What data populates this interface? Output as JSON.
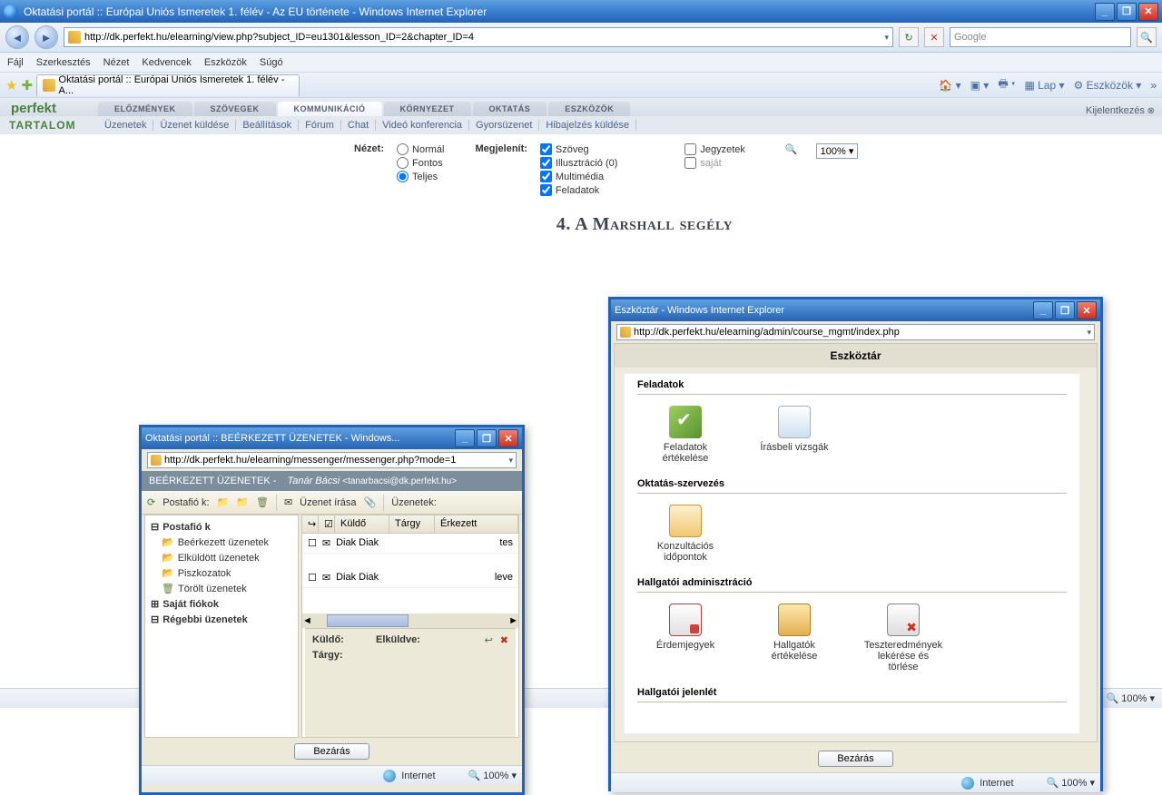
{
  "main_window": {
    "title": "Oktatási portál :: Európai Uniós Ismeretek 1. félév - Az EU története - Windows Internet Explorer",
    "url": "http://dk.perfekt.hu/elearning/view.php?subject_ID=eu1301&lesson_ID=2&chapter_ID=4",
    "search_placeholder": "Google",
    "tab_label": "Oktatási portál :: Európai Uniós Ismeretek 1. félév - A..."
  },
  "menus": {
    "file": "Fájl",
    "edit": "Szerkesztés",
    "view": "Nézet",
    "favs": "Kedvencek",
    "tools": "Eszközök",
    "help": "Súgó"
  },
  "toolbar": {
    "page": "Lap",
    "tools": "Eszközök"
  },
  "portal": {
    "logo": "perfekt",
    "tabs": [
      "ELŐZMÉNYEK",
      "SZÖVEGEK",
      "KOMMUNIKÁCIÓ",
      "KÖRNYEZET",
      "OKTATÁS",
      "ESZKÖZÖK"
    ],
    "tartalom": "TARTALOM",
    "subnav": [
      "Üzenetek",
      "Üzenet küldése",
      "Beállítások",
      "Fórum",
      "Chat",
      "Videó konferencia",
      "Gyorsüzenet",
      "Hibajelzés küldése"
    ],
    "logout": "Kijelentkezés"
  },
  "options": {
    "nezet": "Nézet:",
    "megj": "Megjelenít:",
    "normal": "Normál",
    "fontos": "Fontos",
    "teljes": "Teljes",
    "szoveg": "Szöveg",
    "illusztracio": "Illusztráció   (0)",
    "multimedia": "Multimédia",
    "feladatok": "Feladatok",
    "jegyzetek": "Jegyzetek",
    "sajat": "saját",
    "zoom": "100%"
  },
  "article": {
    "heading": "4. A Marshall segély"
  },
  "popup_msg": {
    "title": "Oktatási portál :: BEÉRKEZETT ÜZENETEK - Windows...",
    "url": "http://dk.perfekt.hu/elearning/messenger/messenger.php?mode=1",
    "header": "BEÉRKEZETT ÜZENETEK  -",
    "from": "Tanár Bácsi",
    "email": "<tanarbacsi@dk.perfekt.hu>",
    "postafio": "Postafió k:",
    "irasa": "Üzenet írása",
    "uzenetek": "Üzenetek:",
    "tree": {
      "root": "Postafió k",
      "in": "Beérkezett üzenetek",
      "out": "Elküldött üzenetek",
      "draft": "Piszkozatok",
      "trash": "Törölt üzenetek",
      "own": "Saját fiókok",
      "old": "Régebbi üzenetek"
    },
    "cols": {
      "kuldo": "Küldő",
      "targy": "Tárgy",
      "erkezett": "Érkezett"
    },
    "rows": [
      {
        "name": "Diak Diak",
        "extra": "tes"
      },
      {
        "name": "Diak Diak",
        "extra": "leve"
      }
    ],
    "preview": {
      "kuldo": "Küldő:",
      "elkuldve": "Elküldve:",
      "targy": "Tárgy:"
    },
    "close": "Bezárás",
    "zone": "Internet",
    "zoom": "100%"
  },
  "popup_tool": {
    "title": "Eszköztár - Windows Internet Explorer",
    "url": "http://dk.perfekt.hu/elearning/admin/course_mgmt/index.php",
    "heading": "Eszköztár",
    "s1": "Feladatok",
    "t1a": "Feladatok értékelése",
    "t1b": "Írásbeli vizsgák",
    "s2": "Oktatás-szervezés",
    "t2a": "Konzultációs időpontok",
    "s3": "Hallgatói adminisztráció",
    "t3a": "Érdemjegyek",
    "t3b": "Hallgatók értékelése",
    "t3c": "Teszteredmények lekérése és törlése",
    "s4": "Hallgatói jelenlét",
    "close": "Bezárás",
    "zone": "Internet",
    "zoom": "100%"
  },
  "status": {
    "zone": "Internet",
    "zoom": "100%"
  }
}
